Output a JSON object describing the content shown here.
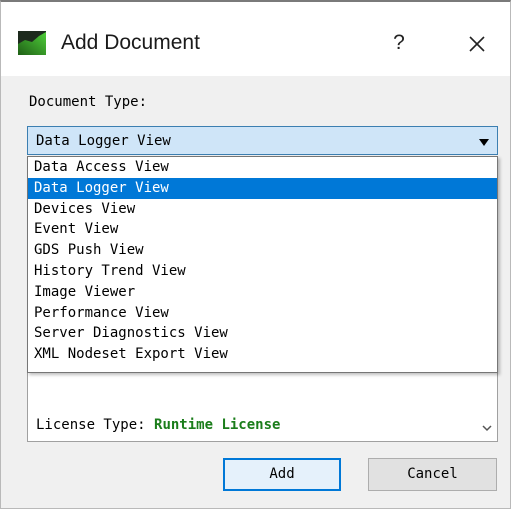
{
  "window": {
    "title": "Add Document",
    "help_label": "?",
    "icon": "app-icon",
    "close_icon": "close-icon"
  },
  "form": {
    "document_type_label": "Document Type:",
    "selected_value": "Data Logger View",
    "options": [
      "Data Access View",
      "Data Logger View",
      "Devices View",
      "Event View",
      "GDS Push View",
      "History Trend View",
      "Image Viewer",
      "Performance View",
      "Server Diagnostics View",
      "XML Nodeset Export View"
    ],
    "highlighted_index": 1
  },
  "details": {
    "license_label": "License Type:",
    "license_value": "Runtime License",
    "license_color": "#1b7d1b"
  },
  "buttons": {
    "add": "Add",
    "cancel": "Cancel"
  },
  "colors": {
    "selection": "#0078d7",
    "combo_background": "#cfe5f8"
  }
}
